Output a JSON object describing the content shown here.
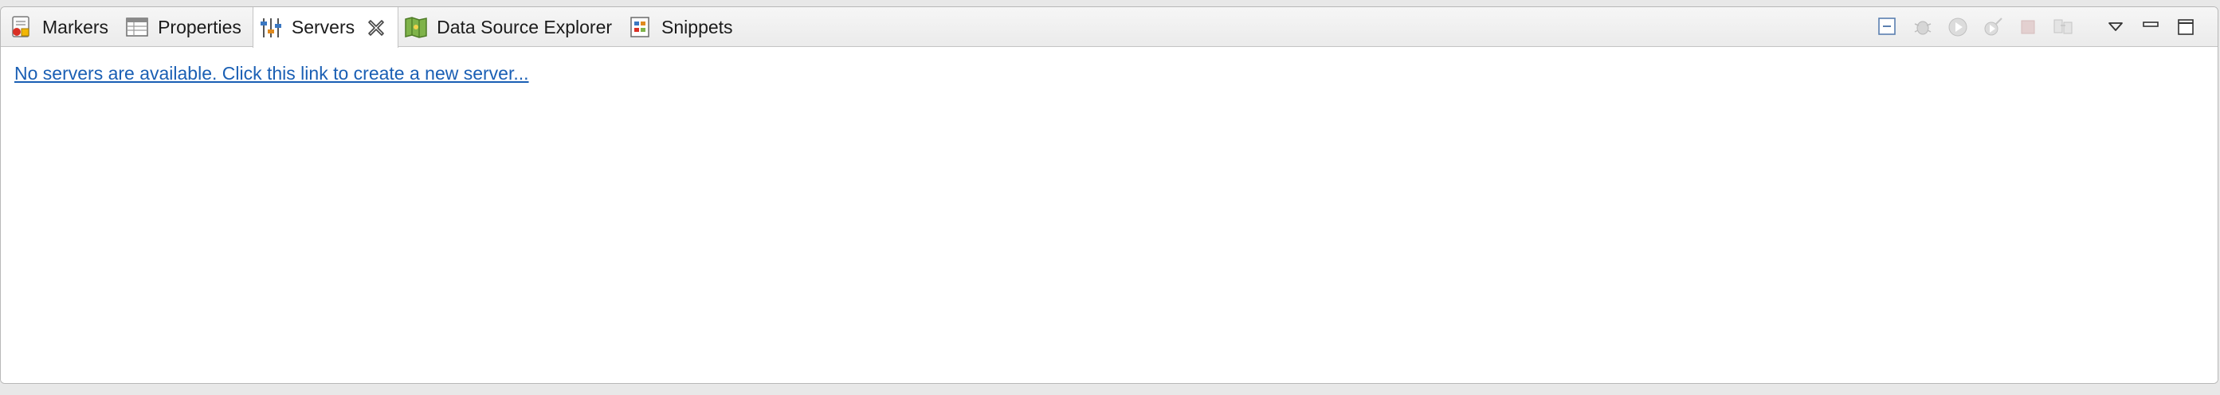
{
  "tabs": [
    {
      "label": "Markers",
      "icon": "markers-icon",
      "active": false
    },
    {
      "label": "Properties",
      "icon": "properties-icon",
      "active": false
    },
    {
      "label": "Servers",
      "icon": "servers-icon",
      "active": true
    },
    {
      "label": "Data Source Explorer",
      "icon": "data-source-explorer-icon",
      "active": false
    },
    {
      "label": "Snippets",
      "icon": "snippets-icon",
      "active": false
    }
  ],
  "servers_view": {
    "empty_link": "No servers are available. Click this link to create a new server..."
  },
  "toolbar": {
    "buttons": [
      "collapse-all-icon",
      "debug-server-icon",
      "start-server-icon",
      "profile-server-icon",
      "stop-server-icon",
      "publish-server-icon",
      "view-menu-icon",
      "minimize-icon",
      "maximize-icon"
    ]
  },
  "colors": {
    "link": "#1a5fb4",
    "tabbar_bg": "#ececec",
    "content_bg": "#ffffff",
    "border": "#c4c4c4"
  }
}
